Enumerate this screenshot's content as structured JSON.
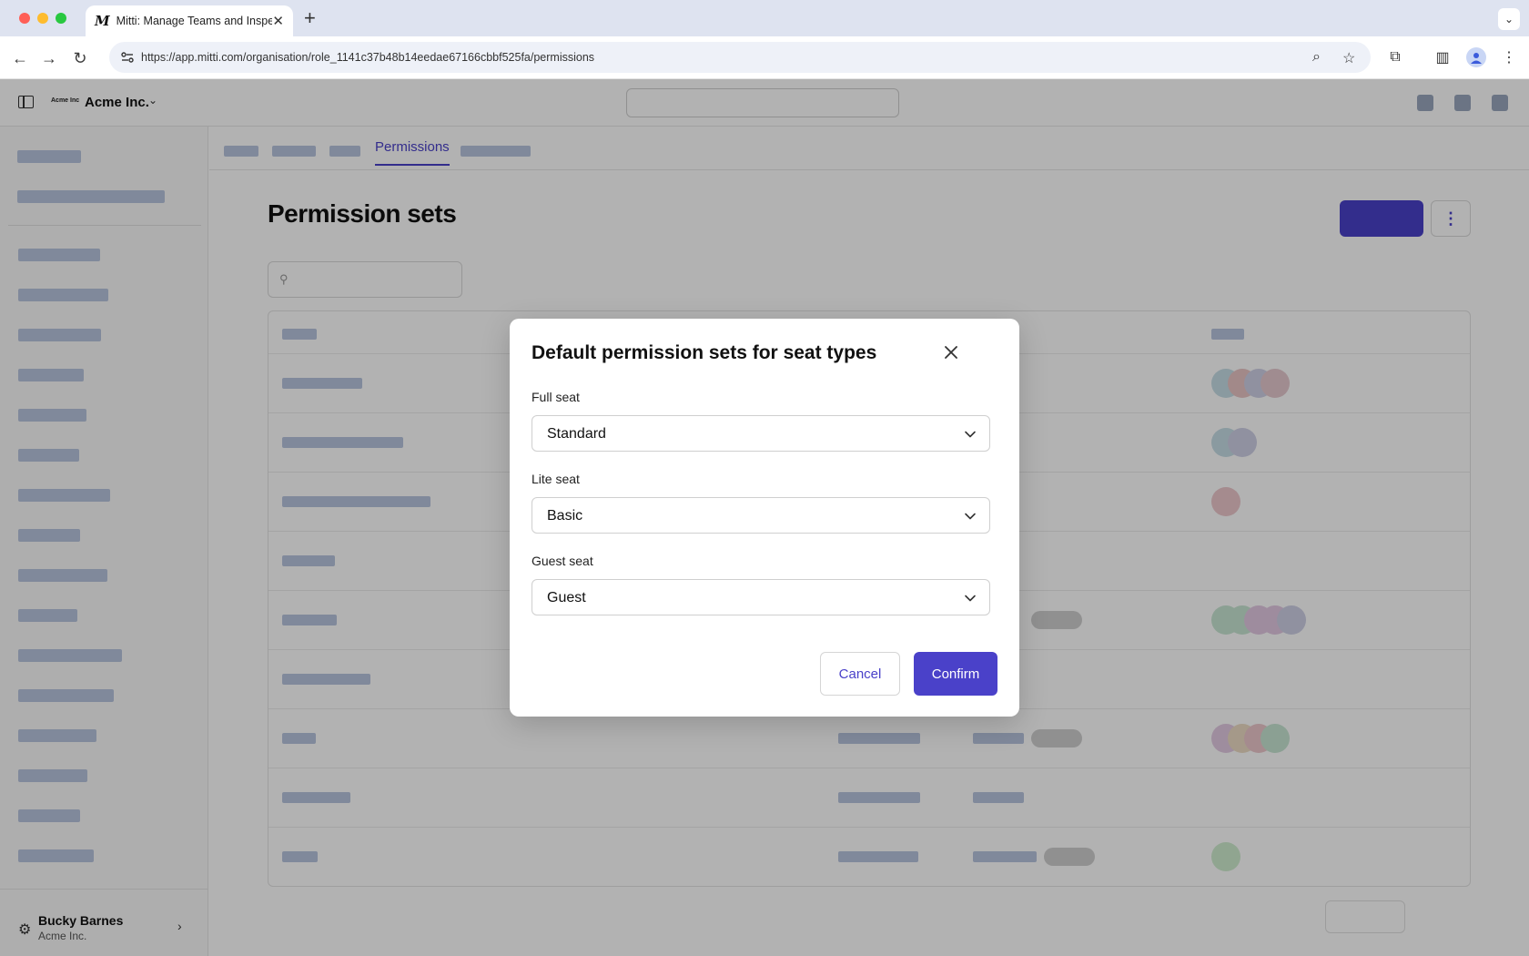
{
  "browser": {
    "tab_title": "Mitti: Manage Teams and Inspect...",
    "tab_favicon": "M",
    "url": "https://app.mitti.com/organisation/role_1141c37b48b14eedae67166cbbf525fa/permissions"
  },
  "header": {
    "org_logo_text": "Acme Inc",
    "org_name": "Acme Inc."
  },
  "subtabs": {
    "active_label": "Permissions"
  },
  "page": {
    "title": "Permission sets"
  },
  "user": {
    "name": "Bucky Barnes",
    "org": "Acme Inc."
  },
  "modal": {
    "title": "Default permission sets for seat types",
    "fields": [
      {
        "label": "Full seat",
        "value": "Standard"
      },
      {
        "label": "Lite seat",
        "value": "Basic"
      },
      {
        "label": "Guest seat",
        "value": "Guest"
      }
    ],
    "cancel_label": "Cancel",
    "confirm_label": "Confirm"
  },
  "colors": {
    "accent": "#4a41c9"
  },
  "icons": {
    "close": "close-icon",
    "chevron": "chevron-down-icon",
    "settings": "gear-icon"
  }
}
